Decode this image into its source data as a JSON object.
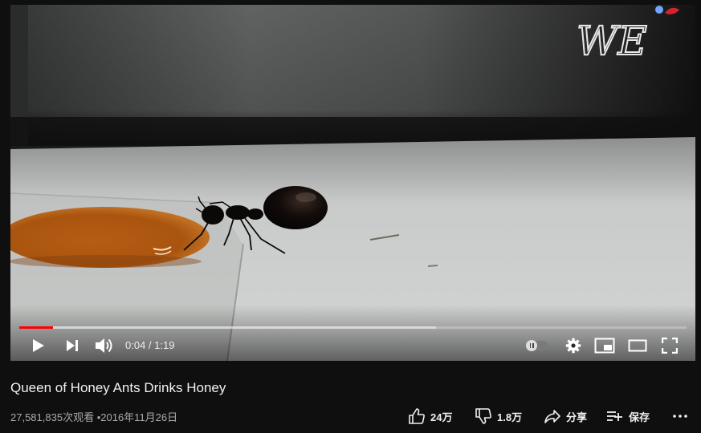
{
  "player": {
    "watermark": "WE",
    "progress": {
      "played_fraction": 0.05,
      "buffered_fraction": 0.625
    },
    "current_time": "0:04",
    "separator": " / ",
    "duration": "1:19"
  },
  "video": {
    "title": "Queen of Honey Ants Drinks Honey",
    "views": "27,581,835次观看",
    "dot": "•",
    "date": "2016年11月26日"
  },
  "actions": {
    "like_count": "24万",
    "dislike_count": "1.8万",
    "share_label": "分享",
    "save_label": "保存"
  },
  "colors": {
    "background": "#0f0f0f",
    "progress_played": "#ff0000",
    "meta_text": "#aaaaaa"
  },
  "icons": [
    "play-icon",
    "next-icon",
    "volume-icon",
    "autoplay-toggle",
    "settings-icon",
    "miniplayer-icon",
    "theater-icon",
    "fullscreen-icon",
    "like-icon",
    "dislike-icon",
    "share-icon",
    "save-icon",
    "more-icon"
  ]
}
